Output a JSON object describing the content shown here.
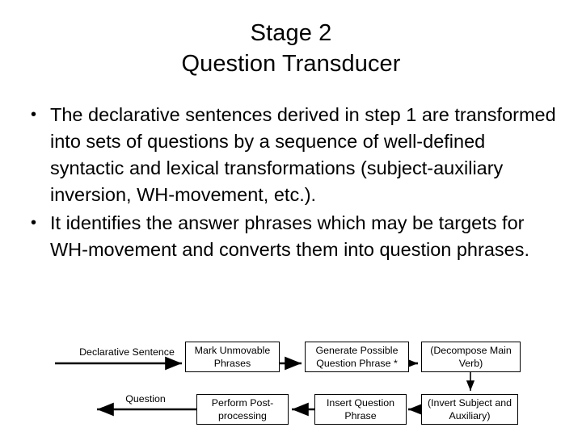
{
  "slide": {
    "title_lines": [
      "Stage 2",
      "Question Transducer"
    ],
    "bullets": [
      "The declarative sentences derived in step 1 are transformed into sets of questions by a sequence of well-defined syntactic and lexical transformations (subject-auxiliary inversion, WH-movement, etc.).",
      "It identifies the answer phrases which may be targets for WH-movement and converts them into question phrases."
    ],
    "bullet_marker": "•"
  },
  "diagram": {
    "nodes": [
      {
        "id": "mark-unmovable-phrases",
        "label": "Mark Unmovable Phrases"
      },
      {
        "id": "generate-possible-question-phrase",
        "label": "Generate Possible Question Phrase *"
      },
      {
        "id": "decompose-main-verb",
        "label": "(Decompose Main Verb)"
      },
      {
        "id": "invert-subject-and-auxiliary",
        "label": "(Invert Subject and Auxiliary)"
      },
      {
        "id": "insert-question-phrase",
        "label": "Insert Question Phrase"
      },
      {
        "id": "perform-post-processing",
        "label": "Perform Post-processing"
      }
    ],
    "edge_labels": {
      "input": "Declarative Sentence",
      "output": "Question"
    },
    "stroke_color": "#000000"
  }
}
